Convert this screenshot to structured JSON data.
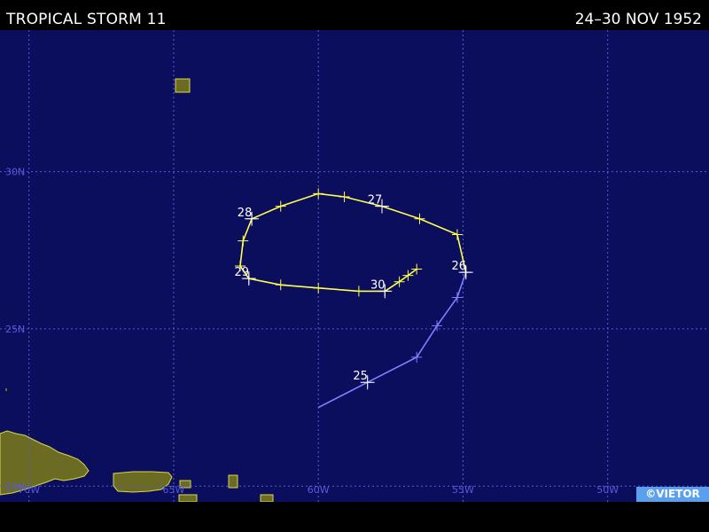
{
  "header": {
    "title": "TROPICAL STORM 11",
    "dates": "24–30 NOV 1952"
  },
  "credit": "©VIETOR",
  "colors": {
    "ocean": "#0b0e5c",
    "grid": "#5a5ad8",
    "land": "#6b6b23",
    "landEdge": "#d8d84a",
    "weakStage": "#8080ff",
    "stormStage": "#ffff4d",
    "dayLabel": "#ffffff"
  },
  "axes": {
    "lon_range": [
      -71,
      -46.5
    ],
    "lat_range": [
      19.5,
      34.5
    ],
    "lon_lines": [
      -70,
      -65,
      -60,
      -55,
      -50
    ],
    "lat_lines": [
      20,
      25,
      30
    ],
    "lon_labels": [
      "70W",
      "65W",
      "60W",
      "55W",
      "50W"
    ],
    "lat_labels": [
      "20N",
      "25N",
      "30N"
    ]
  },
  "track": {
    "weak_points": [
      [
        -60.0,
        22.5
      ],
      [
        -58.3,
        23.3
      ],
      [
        -56.6,
        24.1
      ],
      [
        -55.9,
        25.1
      ],
      [
        -55.2,
        26.0
      ],
      [
        -54.9,
        26.8
      ]
    ],
    "storm_points": [
      [
        -54.9,
        26.8
      ],
      [
        -55.2,
        28.0
      ],
      [
        -56.5,
        28.5
      ],
      [
        -57.8,
        28.9
      ],
      [
        -59.1,
        29.2
      ],
      [
        -60.0,
        29.3
      ],
      [
        -61.3,
        28.9
      ],
      [
        -62.3,
        28.5
      ],
      [
        -62.6,
        27.8
      ],
      [
        -62.7,
        27.0
      ],
      [
        -62.4,
        26.6
      ],
      [
        -61.3,
        26.4
      ],
      [
        -60.0,
        26.3
      ],
      [
        -58.6,
        26.2
      ],
      [
        -57.7,
        26.2
      ],
      [
        -57.2,
        26.5
      ],
      [
        -56.9,
        26.7
      ],
      [
        -56.6,
        26.9
      ]
    ],
    "day_labels": [
      {
        "text": "25",
        "lon": -58.3,
        "lat": 23.3
      },
      {
        "text": "26",
        "lon": -54.9,
        "lat": 26.8
      },
      {
        "text": "27",
        "lon": -57.8,
        "lat": 28.9
      },
      {
        "text": "28",
        "lon": -62.3,
        "lat": 28.5
      },
      {
        "text": "29",
        "lon": -62.4,
        "lat": 26.6
      },
      {
        "text": "30",
        "lon": -57.7,
        "lat": 26.2
      }
    ]
  }
}
